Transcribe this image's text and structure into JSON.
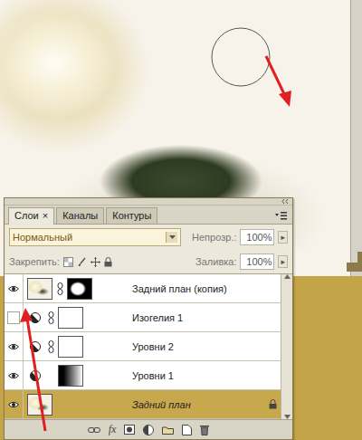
{
  "panel": {
    "tabs": [
      {
        "label": "Слои",
        "selected": true,
        "close": "×"
      },
      {
        "label": "Каналы",
        "selected": false
      },
      {
        "label": "Контуры",
        "selected": false
      }
    ],
    "blend_mode": {
      "value": "Нормальный"
    },
    "opacity": {
      "label": "Непрозр.:",
      "value": "100%",
      "arrow": "▸"
    },
    "lock": {
      "label": "Закрепить:"
    },
    "fill": {
      "label": "Заливка:",
      "value": "100%",
      "arrow": "▸"
    },
    "layers": [
      {
        "name": "Задний план (копия)",
        "kind": "pixel",
        "visible": true,
        "selected": false,
        "linked": true,
        "mask": "shape",
        "locked": false
      },
      {
        "name": "Изогелия 1",
        "kind": "adjustment",
        "visible": false,
        "selected": false,
        "linked": true,
        "mask": "white",
        "locked": false
      },
      {
        "name": "Уровни 2",
        "kind": "adjustment",
        "visible": true,
        "selected": false,
        "linked": true,
        "mask": "white",
        "locked": false
      },
      {
        "name": "Уровни 1",
        "kind": "adjustment",
        "visible": true,
        "selected": false,
        "linked": false,
        "mask": "gradient",
        "locked": false
      },
      {
        "name": "Задний план",
        "kind": "pixel",
        "visible": true,
        "selected": true,
        "linked": false,
        "mask": "none",
        "locked": true
      }
    ],
    "toolbar": {
      "fx": "fx"
    }
  }
}
